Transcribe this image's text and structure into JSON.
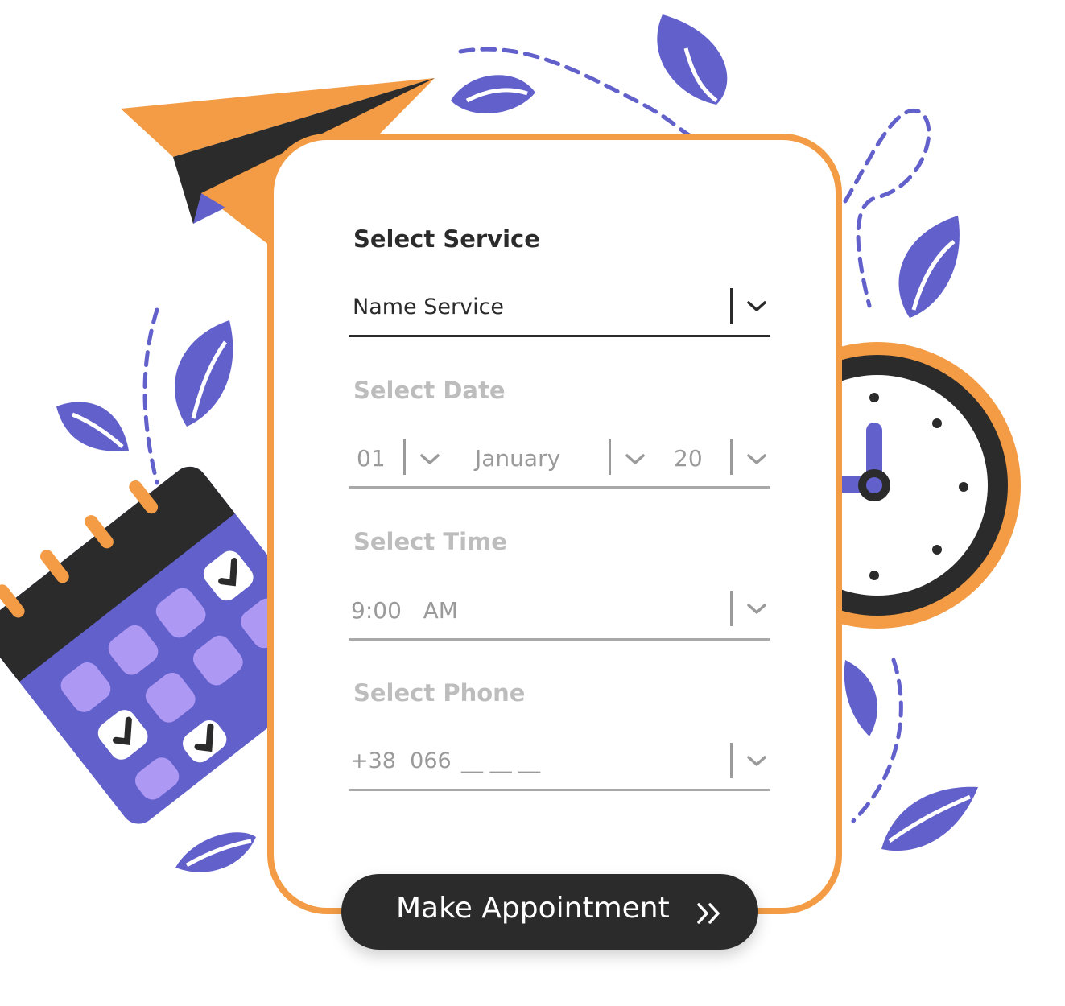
{
  "colors": {
    "accent": "#F39C45",
    "purple": "#6260CB",
    "light_purple": "#AD98F4",
    "dark": "#2B2B2B",
    "muted_text": "#BDBDBD",
    "muted_value": "#9A9A9A",
    "muted_line": "#A8A8A8"
  },
  "form": {
    "service": {
      "title": "Select Service",
      "value": "Name Service"
    },
    "date": {
      "title": "Select Date",
      "day": "01",
      "month": "January",
      "year": "20"
    },
    "time": {
      "title": "Select Time",
      "value": "9:00   AM"
    },
    "phone": {
      "title": "Select Phone",
      "prefix": "+38  066",
      "mask": "__ __ __"
    },
    "submit": {
      "label": "Make Appointment",
      "icon": "double-chevron-right-icon"
    }
  },
  "decor": {
    "icons": [
      "paper-plane-icon",
      "calendar-icon",
      "clock-icon",
      "leaf-icon",
      "dashed-path"
    ]
  }
}
